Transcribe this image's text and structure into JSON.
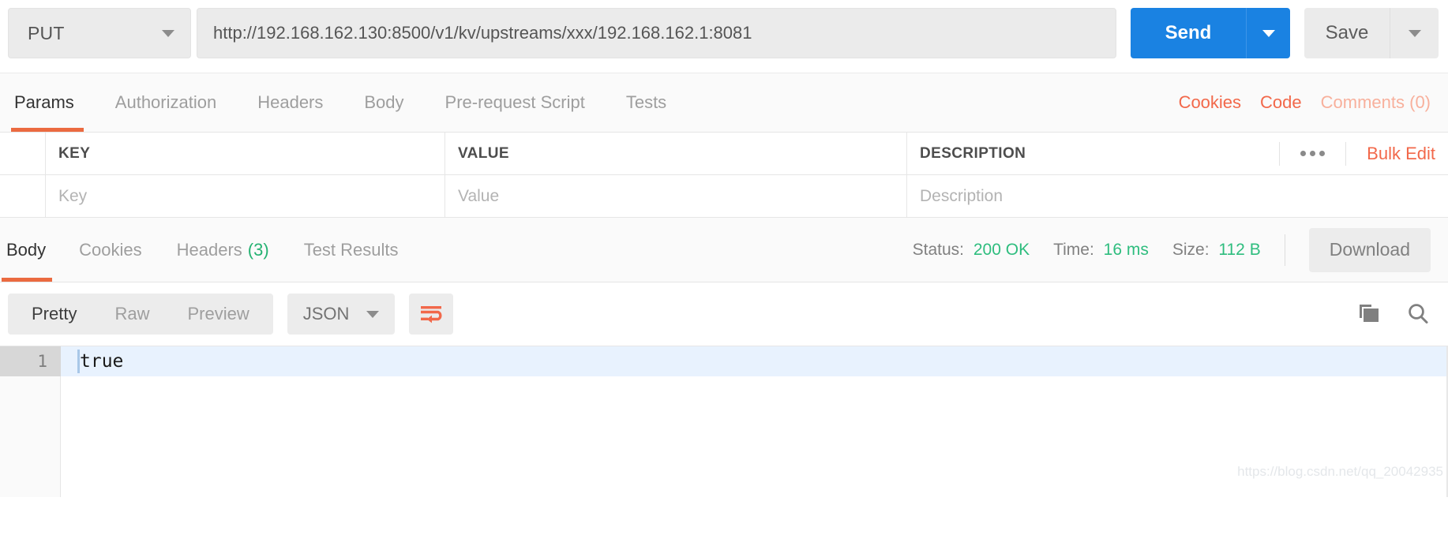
{
  "request_bar": {
    "method": "PUT",
    "method_caret_icon": "chevron-down-icon",
    "url": "http://192.168.162.130:8500/v1/kv/upstreams/xxx/192.168.162.1:8081",
    "url_placeholder": "Enter request URL",
    "send_label": "Send",
    "send_caret_icon": "chevron-down-icon",
    "save_label": "Save",
    "save_caret_icon": "chevron-down-icon",
    "accent_blue": "#1a82e2"
  },
  "request_tabs": {
    "items": [
      {
        "label": "Params",
        "active": true
      },
      {
        "label": "Authorization",
        "active": false
      },
      {
        "label": "Headers",
        "active": false
      },
      {
        "label": "Body",
        "active": false
      },
      {
        "label": "Pre-request Script",
        "active": false
      },
      {
        "label": "Tests",
        "active": false
      }
    ],
    "cookies_label": "Cookies",
    "code_label": "Code",
    "comments_label": "Comments (0)",
    "accent_orange": "#f2684a"
  },
  "params_table": {
    "headers": {
      "key": "KEY",
      "value": "VALUE",
      "description": "DESCRIPTION"
    },
    "more_icon": "ellipsis-icon",
    "bulk_edit_label": "Bulk Edit",
    "rows": [
      {
        "key_placeholder": "Key",
        "value_placeholder": "Value",
        "description_placeholder": "Description"
      }
    ]
  },
  "response_tabs": {
    "items": [
      {
        "label": "Body",
        "count": "",
        "active": true
      },
      {
        "label": "Cookies",
        "count": "",
        "active": false
      },
      {
        "label": "Headers",
        "count": "(3)",
        "active": false
      },
      {
        "label": "Test Results",
        "count": "",
        "active": false
      }
    ],
    "status_label": "Status:",
    "status_value": "200 OK",
    "time_label": "Time:",
    "time_value": "16 ms",
    "size_label": "Size:",
    "size_value": "112 B",
    "download_label": "Download",
    "status_green": "#2ebd7e"
  },
  "view_toolbar": {
    "modes": [
      {
        "label": "Pretty",
        "active": true
      },
      {
        "label": "Raw",
        "active": false
      },
      {
        "label": "Preview",
        "active": false
      }
    ],
    "format": "JSON",
    "format_caret_icon": "chevron-down-icon",
    "wrap_icon": "word-wrap-icon",
    "copy_icon": "copy-icon",
    "search_icon": "search-icon"
  },
  "response_body": {
    "lines": [
      {
        "number": "1",
        "text": "true"
      }
    ]
  },
  "watermark": {
    "text": "https://blog.csdn.net/qq_20042935"
  }
}
